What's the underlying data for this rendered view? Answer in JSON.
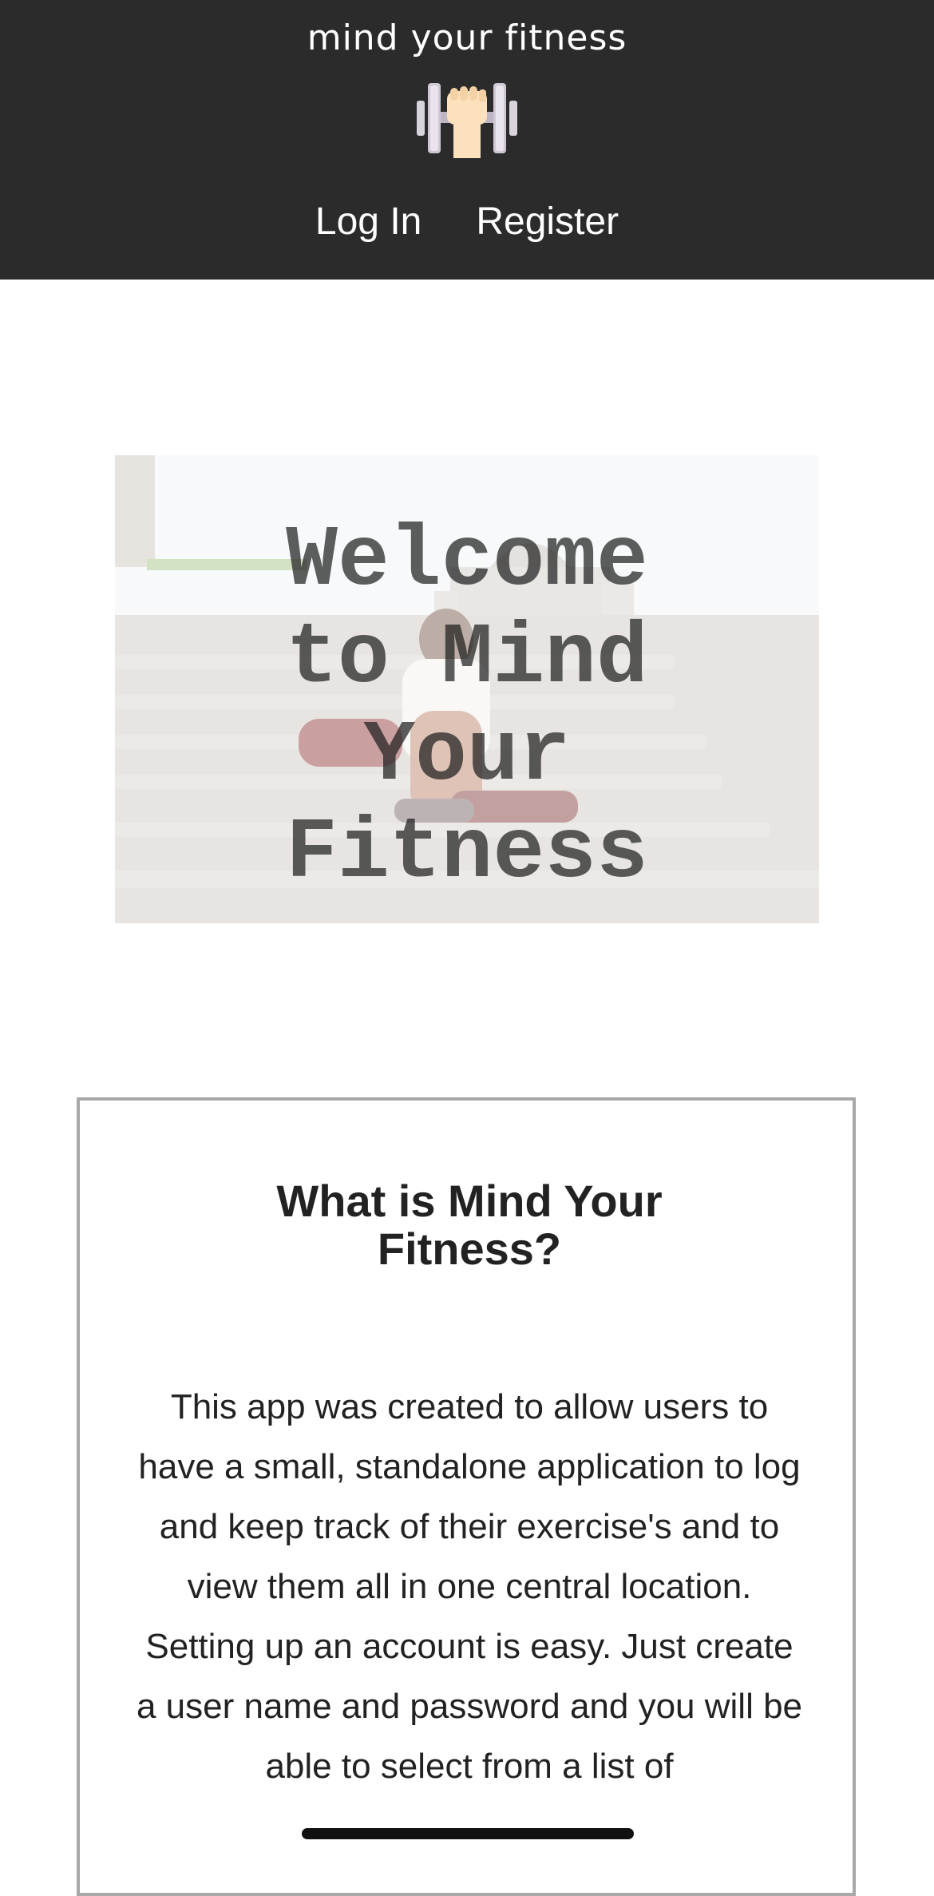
{
  "header": {
    "brand": "mind your fitness",
    "logo_icon": "dumbbell-fist-icon",
    "nav": {
      "login_label": "Log In",
      "register_label": "Register"
    },
    "background_color": "#2b2b2b"
  },
  "hero": {
    "title": "Welcome to Mind Your Fitness",
    "image_description": "runner-tying-shoes-photo"
  },
  "info": {
    "title": "What is Mind Your Fitness?",
    "body": "This app was created to allow users to have a small, standalone application to log and keep track of their exercise's and to view them all in one central location. Setting up an account is easy. Just create a user name and password and you will be able to select from a list of"
  }
}
